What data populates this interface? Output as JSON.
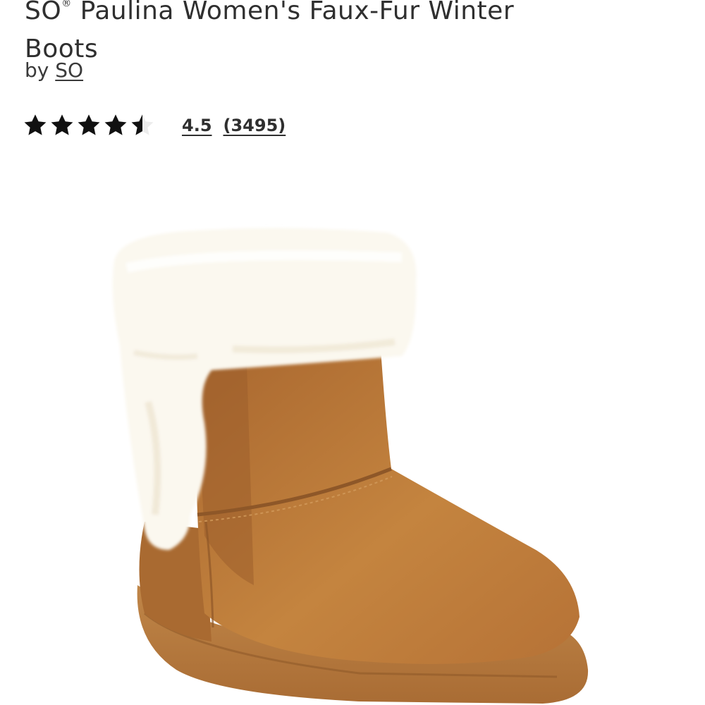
{
  "product": {
    "title_line1_prefix": "SO",
    "title_trademark": "®",
    "title_line1_rest": " Paulina Women's Faux-Fur Winter",
    "title_line2": "Boots",
    "by_label": "by",
    "brand": "SO"
  },
  "rating": {
    "value": "4.5",
    "count": "(3495)",
    "stars_filled_fraction": 0.9,
    "star_color": "#111111"
  },
  "image": {
    "icon": "faux-fur-boot-image",
    "boot_color": "#b9773c",
    "fur_color": "#fbf8ef"
  }
}
